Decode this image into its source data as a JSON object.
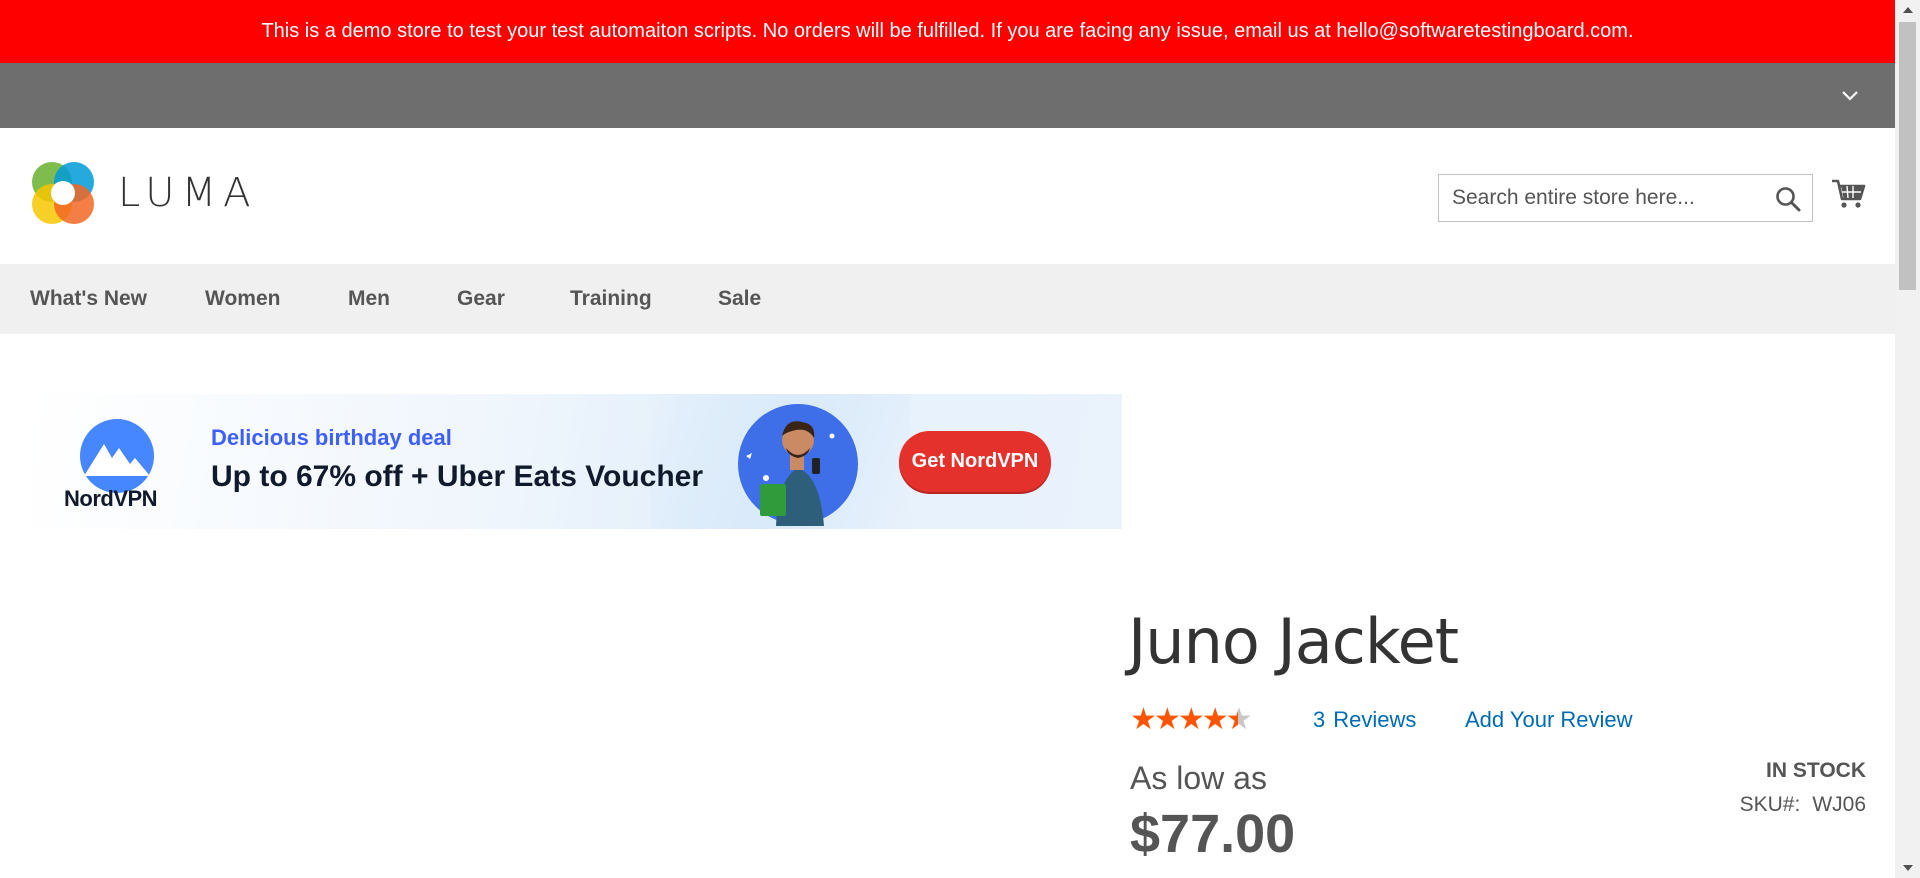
{
  "notice": {
    "text": "This is a demo store to test your test automaiton scripts. No orders will be fulfilled. If you are facing any issue, email us at hello@softwaretestingboard.com."
  },
  "header": {
    "logo_text": "LUMA",
    "search_placeholder": "Search entire store here...",
    "search_value": "",
    "search_icon": "search-icon",
    "cart_icon": "cart-icon"
  },
  "nav": {
    "items": [
      {
        "label": "What's New"
      },
      {
        "label": "Women"
      },
      {
        "label": "Men"
      },
      {
        "label": "Gear"
      },
      {
        "label": "Training"
      },
      {
        "label": "Sale"
      }
    ]
  },
  "ad": {
    "brand": "NordVPN",
    "tagline": "Delicious birthday deal",
    "headline": "Up to 67% off + Uber Eats Voucher",
    "cta": "Get NordVPN",
    "colors": {
      "accent": "#3e5fff",
      "cta": "#e5312b",
      "dark": "#101a2c"
    }
  },
  "product": {
    "title": "Juno Jacket",
    "rating": 4.5,
    "rating_max": 5,
    "review_count": "3",
    "reviews_label": "Reviews",
    "add_review_label": "Add Your Review",
    "price_label": "As low as",
    "price": "$77.00",
    "stock": "In stock",
    "sku_label": "SKU#:",
    "sku": "WJ06"
  },
  "colors": {
    "notice_bg": "#ff0000",
    "panel_bg": "#6e6e6e",
    "nav_bg": "#f0f0f0",
    "link": "#006bb4",
    "rating": "#ff5501"
  }
}
